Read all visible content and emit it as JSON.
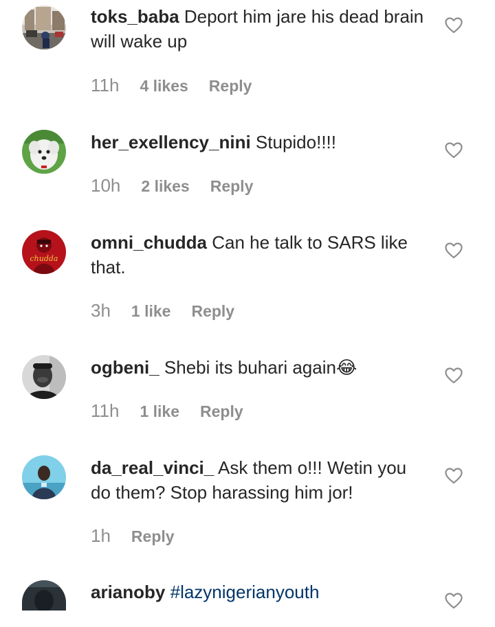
{
  "comments": [
    {
      "username": "toks_baba",
      "text": "Deport him jare his dead brain will wake up",
      "time": "11h",
      "likes": "4 likes",
      "reply": "Reply",
      "avatar_icon": "street-scene-avatar"
    },
    {
      "username": "her_exellency_nini",
      "text": "Stupido!!!!",
      "time": "10h",
      "likes": "2 likes",
      "reply": "Reply",
      "avatar_icon": "white-dog-avatar"
    },
    {
      "username": "omni_chudda",
      "text": "Can he talk to SARS like that.",
      "time": "3h",
      "likes": "1 like",
      "reply": "Reply",
      "avatar_icon": "chudda-logo-avatar",
      "avatar_text": "chudda"
    },
    {
      "username": "ogbeni_",
      "text": "Shebi its buhari again😂",
      "time": "11h",
      "likes": "1 like",
      "reply": "Reply",
      "avatar_icon": "man-portrait-avatar"
    },
    {
      "username": "da_real_vinci_",
      "text": "Ask them o!!! Wetin you do them? Stop harassing him jor!",
      "time": "1h",
      "reply": "Reply",
      "avatar_icon": "person-portrait-avatar"
    },
    {
      "username": "arianoby",
      "hashtag": "#lazynigerianyouth",
      "avatar_icon": "dark-portrait-avatar"
    }
  ],
  "colors": {
    "text": "#262626",
    "meta": "#8e8e8e",
    "hashtag": "#003569"
  }
}
